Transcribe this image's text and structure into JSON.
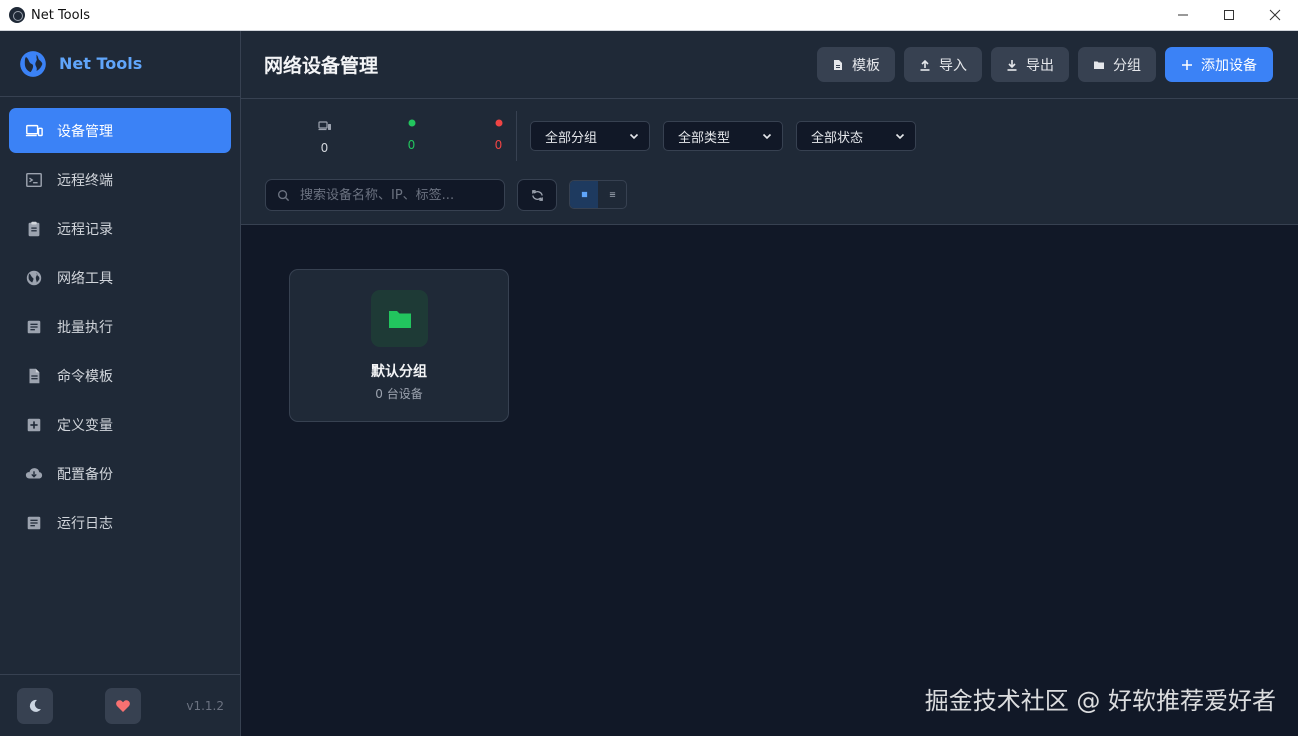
{
  "window": {
    "title": "Net Tools"
  },
  "brand": {
    "name": "Net Tools"
  },
  "sidebar": {
    "items": [
      {
        "label": "设备管理",
        "icon": "devices-icon",
        "active": true
      },
      {
        "label": "远程终端",
        "icon": "terminal-icon"
      },
      {
        "label": "远程记录",
        "icon": "clipboard-icon"
      },
      {
        "label": "网络工具",
        "icon": "globe-icon"
      },
      {
        "label": "批量执行",
        "icon": "list-icon"
      },
      {
        "label": "命令模板",
        "icon": "document-icon"
      },
      {
        "label": "定义变量",
        "icon": "plus-box-icon"
      },
      {
        "label": "配置备份",
        "icon": "cloud-download-icon"
      },
      {
        "label": "运行日志",
        "icon": "log-icon"
      }
    ],
    "version": "v1.1.2"
  },
  "header": {
    "title": "网络设备管理",
    "buttons": {
      "template": "模板",
      "import": "导入",
      "export": "导出",
      "group": "分组",
      "add": "添加设备"
    }
  },
  "stats": {
    "total": "0",
    "online": "0",
    "offline": "0"
  },
  "filters": {
    "group_select": "全部分组",
    "type_select": "全部类型",
    "status_select": "全部状态",
    "search_placeholder": "搜索设备名称、IP、标签..."
  },
  "groups": [
    {
      "name": "默认分组",
      "count_text": "0 台设备"
    }
  ],
  "watermark": "掘金技术社区 @ 好软推荐爱好者",
  "colors": {
    "accent": "#3b82f6",
    "online": "#22c55e",
    "offline": "#ef4444",
    "sidebar_bg": "#1f2937",
    "content_bg": "#111827"
  }
}
